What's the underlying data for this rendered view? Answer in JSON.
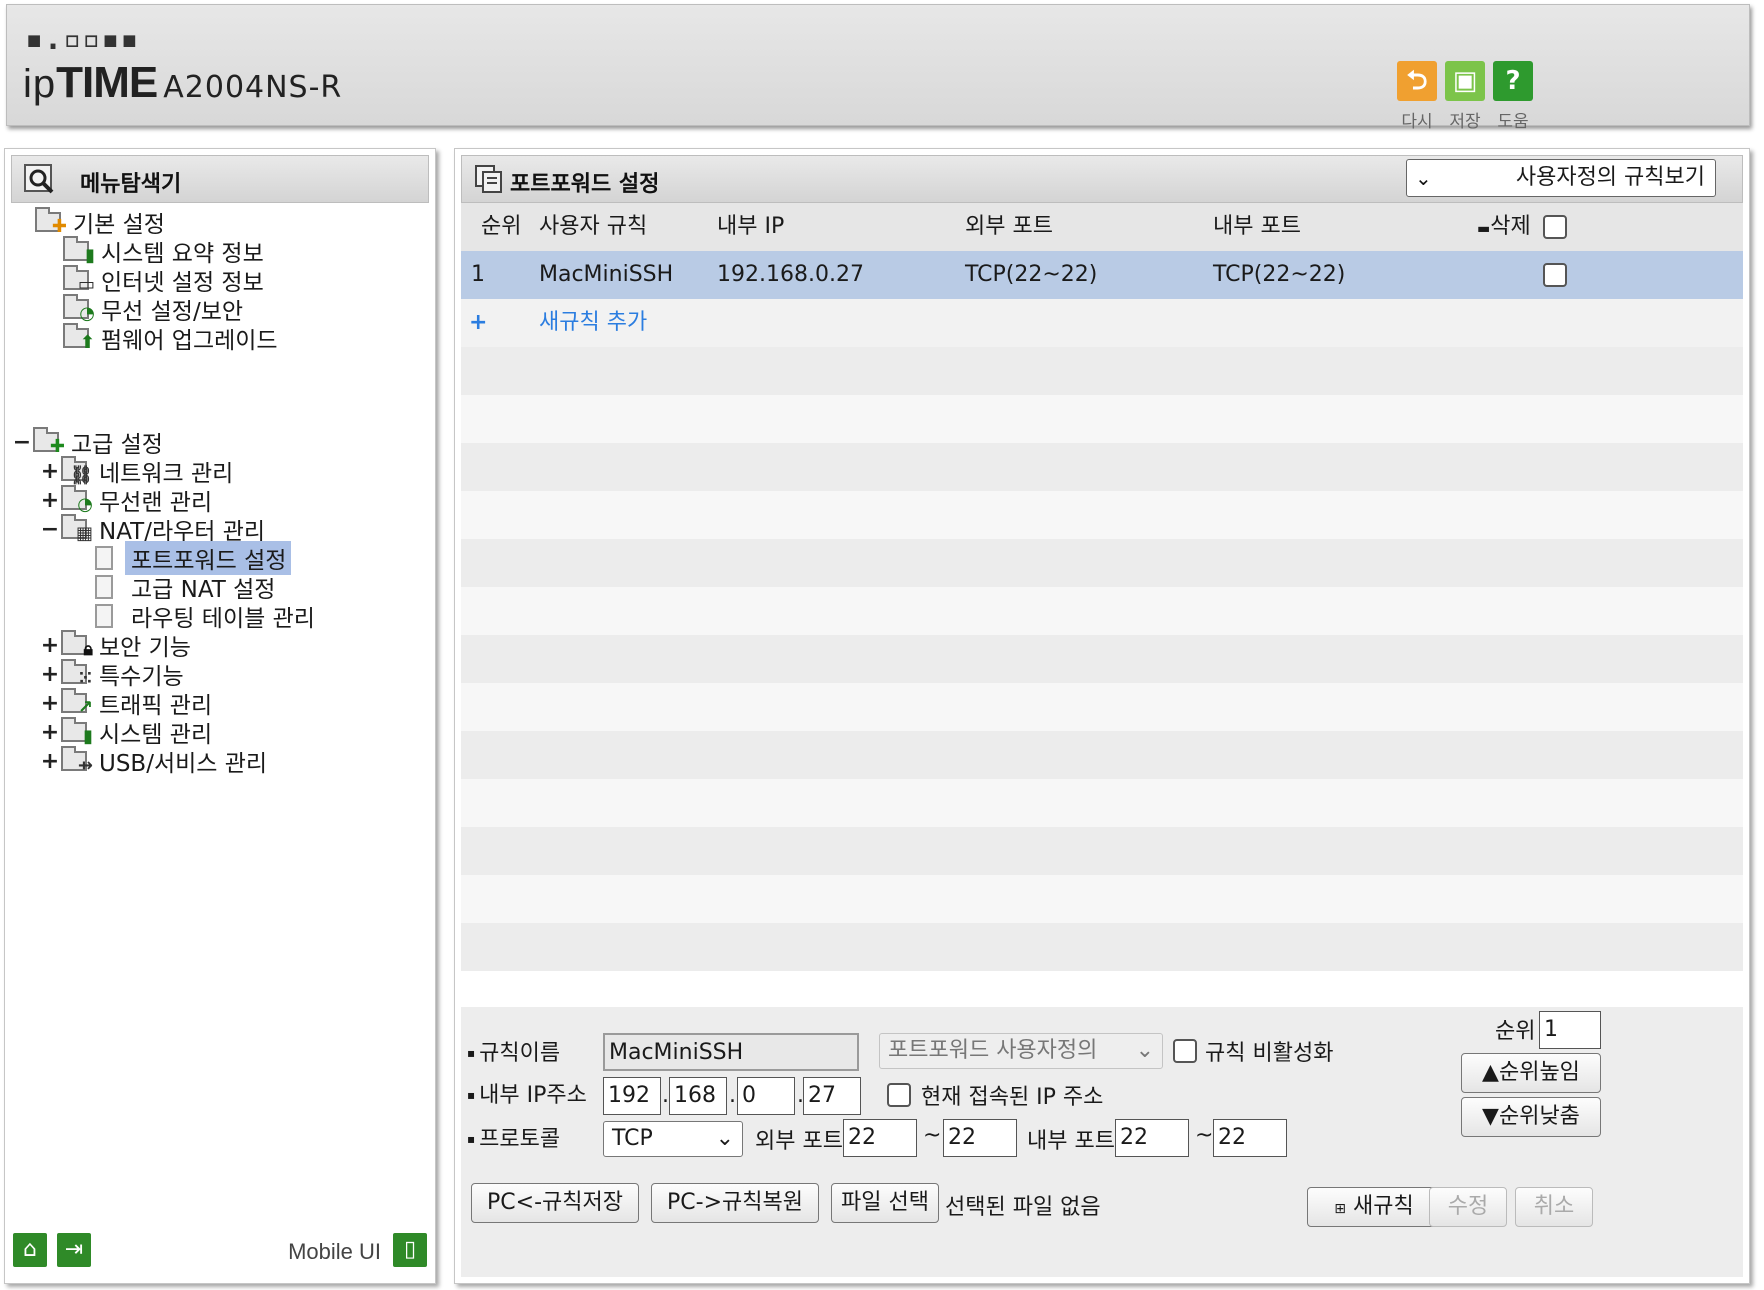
{
  "header": {
    "logo_dots": "▪.▫▫▪▪",
    "brand_ip": "ip",
    "brand_time": "TIME",
    "model": "A2004NS-R",
    "buttons": [
      {
        "name": "reload-button",
        "icon": "undo-icon",
        "label": "다시",
        "color": "#f0a030"
      },
      {
        "name": "save-button",
        "icon": "floppy-icon",
        "label": "저장",
        "color": "#7cc44a"
      },
      {
        "name": "help-button",
        "icon": "help-icon",
        "label": "도움",
        "color": "#2e9a2e"
      }
    ]
  },
  "sidebar": {
    "title": "메뉴탐색기",
    "basic": {
      "label": "기본 설정",
      "items": [
        "시스템 요약 정보",
        "인터넷 설정 정보",
        "무선 설정/보안",
        "펌웨어 업그레이드"
      ]
    },
    "advanced": {
      "expander": "−",
      "label": "고급 설정",
      "items": [
        {
          "expander": "+",
          "label": "네트워크 관리"
        },
        {
          "expander": "+",
          "label": "무선랜 관리"
        },
        {
          "expander": "−",
          "label": "NAT/라우터 관리"
        },
        {
          "expander": "+",
          "label": "보안 기능"
        },
        {
          "expander": "+",
          "label": "특수기능"
        },
        {
          "expander": "+",
          "label": "트래픽 관리"
        },
        {
          "expander": "+",
          "label": "시스템 관리"
        },
        {
          "expander": "+",
          "label": "USB/서비스 관리"
        }
      ],
      "nat_children": [
        "포트포워드 설정",
        "고급 NAT 설정",
        "라우팅 테이블 관리"
      ],
      "selected": "포트포워드 설정"
    },
    "footer": {
      "mobile_label": "Mobile UI"
    }
  },
  "main": {
    "title": "포트포워드 설정",
    "rule_view": "사용자정의 규칙보기",
    "columns": {
      "order": "순위",
      "rule": "사용자 규칙",
      "internal_ip": "내부 IP",
      "external_port": "외부 포트",
      "internal_port": "내부 포트",
      "delete": "삭제"
    },
    "rows": [
      {
        "order": "1",
        "rule": "MacMiniSSH",
        "internal_ip": "192.168.0.27",
        "external_port": "TCP(22~22)",
        "internal_port": "TCP(22~22)",
        "checked": false
      }
    ],
    "add_rule": {
      "icon": "+",
      "label": "새규칙 추가"
    }
  },
  "form": {
    "rule_name_label": "규칙이름",
    "rule_name": "MacMiniSSH",
    "preset_select": "포트포워드 사용자정의",
    "disable_rule_label": "규칙 비활성화",
    "ip_label": "내부 IP주소",
    "ip": [
      "192",
      "168",
      "0",
      "27"
    ],
    "current_ip_label": "현재 접속된 IP 주소",
    "protocol_label": "프로토콜",
    "protocol": "TCP",
    "ext_port_label": "외부 포트",
    "ext_port_from": "22",
    "ext_port_to": "22",
    "int_port_label": "내부 포트",
    "int_port_from": "22",
    "int_port_to": "22",
    "tilde": "~",
    "order_label": "순위",
    "order_value": "1",
    "raise_label": "▲순위높임",
    "lower_label": "▼순위낮춤",
    "save_pc": "PC<-규칙저장",
    "restore_pc": "PC->규칙복원",
    "file_select": "파일 선택",
    "file_status": "선택된 파일 없음",
    "new_rule": "새규칙",
    "modify": "수정",
    "cancel": "취소"
  }
}
